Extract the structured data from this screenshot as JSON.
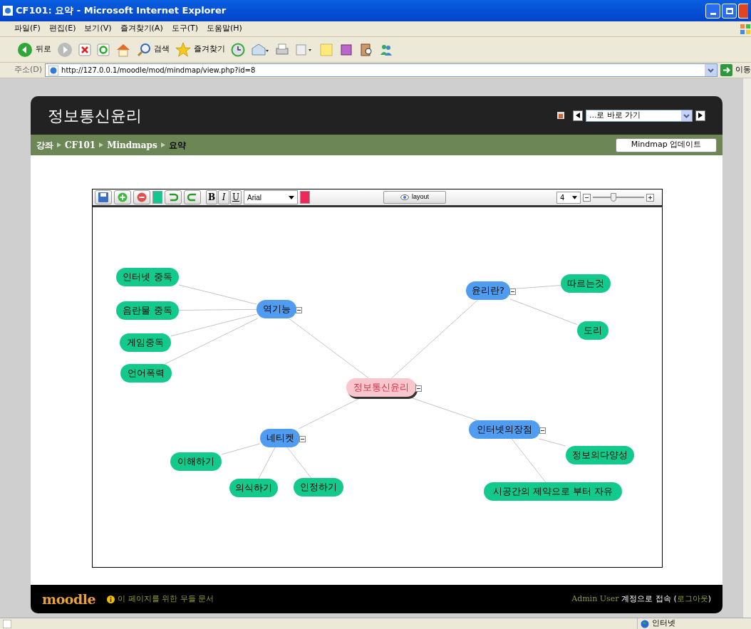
{
  "window": {
    "title": "CF101: 요약 - Microsoft Internet Explorer"
  },
  "menu": [
    "파일(F)",
    "편집(E)",
    "보기(V)",
    "즐겨찾기(A)",
    "도구(T)",
    "도움말(H)"
  ],
  "toolbar": {
    "back": "뒤로",
    "search": "검색",
    "favorites": "즐겨찾기"
  },
  "address": {
    "label": "주소(D)",
    "url": "http://127.0.0.1/moodle/mod/mindmap/view.php?id=8",
    "go": "이동"
  },
  "page": {
    "title": "정보통신윤리",
    "jump": "...로 바로 가기",
    "breadcrumb": [
      "강좌",
      "CF101",
      "Mindmaps",
      "요약"
    ],
    "update_button": "Mindmap 업데이트"
  },
  "editor": {
    "format_buttons": [
      "B",
      "I",
      "U"
    ],
    "font": "Arial",
    "layout_button": "layout",
    "zoom": "4",
    "zoom_slider": {
      "level": 0.4
    },
    "mindmap": {
      "label": "정보통신윤리",
      "kind": "root",
      "expanded": true,
      "children": [
        {
          "label": "역기능",
          "kind": "branch",
          "expanded": true,
          "children": [
            {
              "label": "인터넷 중독",
              "kind": "leaf"
            },
            {
              "label": "음란물 중독",
              "kind": "leaf"
            },
            {
              "label": "게임중독",
              "kind": "leaf"
            },
            {
              "label": "언어폭력",
              "kind": "leaf"
            }
          ]
        },
        {
          "label": "윤리란?",
          "kind": "branch",
          "expanded": true,
          "children": [
            {
              "label": "따르는것",
              "kind": "leaf"
            },
            {
              "label": "도리",
              "kind": "leaf"
            }
          ]
        },
        {
          "label": "네티켓",
          "kind": "branch",
          "expanded": true,
          "children": [
            {
              "label": "이해하기",
              "kind": "leaf"
            },
            {
              "label": "의식하기",
              "kind": "leaf"
            },
            {
              "label": "인정하기",
              "kind": "leaf"
            }
          ]
        },
        {
          "label": "인터넷의장점",
          "kind": "branch",
          "expanded": true,
          "children": [
            {
              "label": "정보의다양성",
              "kind": "leaf"
            },
            {
              "label": "시공간의 제약으로 부터 자유",
              "kind": "leaf"
            }
          ]
        }
      ]
    }
  },
  "footer": {
    "logo": "moodle",
    "docs_link": "이 페이지를 위한 무들 문서",
    "user": "Admin User",
    "login_text": "계정으로 접속 (",
    "logout": "로그아웃",
    "close": ")"
  },
  "status_bar": {
    "zone": "인터넷"
  }
}
